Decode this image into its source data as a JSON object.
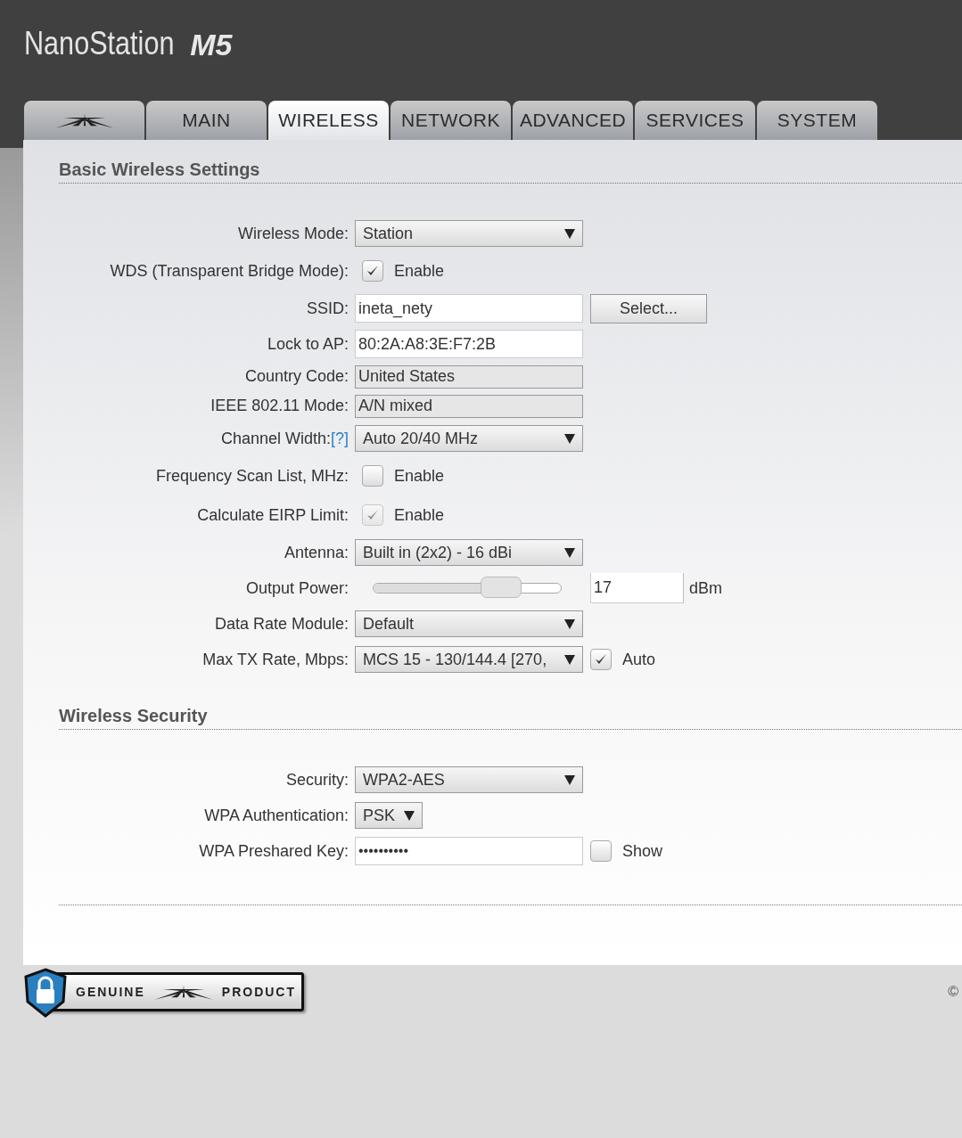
{
  "header": {
    "product": "NanoStation",
    "model": "M5"
  },
  "tabs": [
    {
      "kind": "icon",
      "selected": false
    },
    {
      "kind": "text",
      "label": "MAIN",
      "selected": false
    },
    {
      "kind": "text",
      "label": "WIRELESS",
      "selected": true
    },
    {
      "kind": "text",
      "label": "NETWORK",
      "selected": false
    },
    {
      "kind": "text",
      "label": "ADVANCED",
      "selected": false
    },
    {
      "kind": "text",
      "label": "SERVICES",
      "selected": false
    },
    {
      "kind": "text",
      "label": "SYSTEM",
      "selected": false
    }
  ],
  "sections": [
    {
      "title": "Basic Wireless Settings",
      "rows": [
        {
          "kind": "select",
          "label": "Wireless Mode:",
          "value": "Station"
        },
        {
          "kind": "checkbox",
          "label": "WDS (Transparent Bridge Mode):",
          "checked": true,
          "disabled": false,
          "option": "Enable"
        },
        {
          "kind": "text_button",
          "label": "SSID:",
          "value": "ineta_nety",
          "button": "Select..."
        },
        {
          "kind": "text",
          "label": "Lock to AP:",
          "value": "80:2A:A8:3E:F7:2B"
        },
        {
          "kind": "readonly",
          "label": "Country Code:",
          "value": "United States"
        },
        {
          "kind": "readonly",
          "label": "IEEE 802.11 Mode:",
          "value": "A/N mixed"
        },
        {
          "kind": "select",
          "label": "Channel Width:",
          "help": "[?]",
          "value": "Auto 20/40 MHz"
        },
        {
          "kind": "checkbox",
          "label": "Frequency Scan List, MHz:",
          "checked": false,
          "disabled": false,
          "option": "Enable"
        },
        {
          "kind": "checkbox",
          "label": "Calculate EIRP Limit:",
          "checked": true,
          "disabled": true,
          "option": "Enable"
        },
        {
          "kind": "select",
          "label": "Antenna:",
          "value": "Built in (2x2) - 16 dBi"
        },
        {
          "kind": "slider",
          "label": "Output Power:",
          "level": 0.68,
          "value": "17",
          "unit": "dBm"
        },
        {
          "kind": "select",
          "label": "Data Rate Module:",
          "value": "Default"
        },
        {
          "kind": "select_check",
          "label": "Max TX Rate, Mbps:",
          "value": "MCS 15 - 130/144.4 [270,",
          "checked": true,
          "option": "Auto"
        }
      ]
    },
    {
      "title": "Wireless Security",
      "rows": [
        {
          "kind": "select",
          "label": "Security:",
          "value": "WPA2-AES"
        },
        {
          "kind": "small_select",
          "label": "WPA Authentication:",
          "value": "PSK"
        },
        {
          "kind": "text_check",
          "label": "WPA Preshared Key:",
          "value": "••••••••••",
          "checked": false,
          "option": "Show"
        }
      ]
    }
  ],
  "footer": {
    "badge_left": "GENUINE",
    "badge_right": "PRODUCT",
    "copyright": "©"
  }
}
